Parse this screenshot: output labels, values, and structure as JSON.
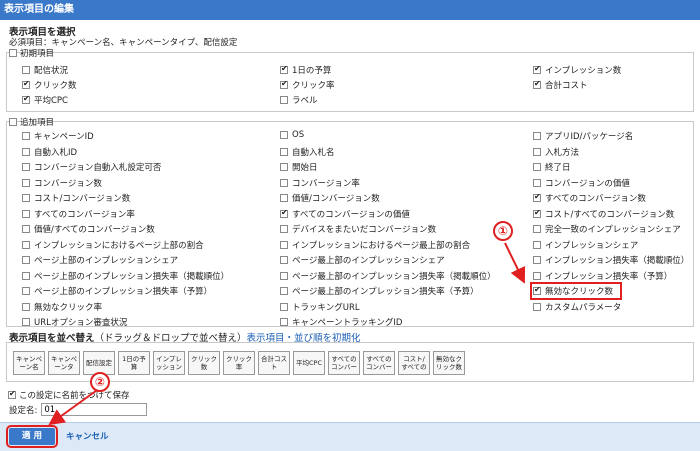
{
  "window": {
    "title": "表示項目の編集"
  },
  "select_section": {
    "heading": "表示項目を選択",
    "required_note": "必須項目：キャンペーン名、キャンペーンタイプ、配信設定"
  },
  "initial_group": {
    "label": "初期項目",
    "checked": false,
    "items": [
      {
        "label": "配信状況",
        "checked": false
      },
      {
        "label": "1日の予算",
        "checked": true
      },
      {
        "label": "インプレッション数",
        "checked": true
      },
      {
        "label": "クリック数",
        "checked": true
      },
      {
        "label": "クリック率",
        "checked": true
      },
      {
        "label": "合計コスト",
        "checked": true
      },
      {
        "label": "平均CPC",
        "checked": true
      },
      {
        "label": "ラベル",
        "checked": false
      }
    ]
  },
  "additional_group": {
    "label": "追加項目",
    "checked": false,
    "items": [
      {
        "label": "キャンペーンID",
        "checked": false
      },
      {
        "label": "OS",
        "checked": false
      },
      {
        "label": "アプリID/パッケージ名",
        "checked": false
      },
      {
        "label": "自動入札ID",
        "checked": false
      },
      {
        "label": "自動入札名",
        "checked": false
      },
      {
        "label": "入札方法",
        "checked": false
      },
      {
        "label": "コンバージョン自動入札設定可否",
        "checked": false
      },
      {
        "label": "開始日",
        "checked": false
      },
      {
        "label": "終了日",
        "checked": false
      },
      {
        "label": "コンバージョン数",
        "checked": false
      },
      {
        "label": "コンバージョン率",
        "checked": false
      },
      {
        "label": "コンバージョンの価値",
        "checked": false
      },
      {
        "label": "コスト/コンバージョン数",
        "checked": false
      },
      {
        "label": "価値/コンバージョン数",
        "checked": false
      },
      {
        "label": "すべてのコンバージョン数",
        "checked": true
      },
      {
        "label": "すべてのコンバージョン率",
        "checked": false
      },
      {
        "label": "すべてのコンバージョンの価値",
        "checked": true
      },
      {
        "label": "コスト/すべてのコンバージョン数",
        "checked": true
      },
      {
        "label": "価値/すべてのコンバージョン数",
        "checked": false
      },
      {
        "label": "デバイスをまたいだコンバージョン数",
        "checked": false
      },
      {
        "label": "完全一致のインプレッションシェア",
        "checked": false
      },
      {
        "label": "インプレッションにおけるページ上部の割合",
        "checked": false
      },
      {
        "label": "インプレッションにおけるページ最上部の割合",
        "checked": false
      },
      {
        "label": "インプレッションシェア",
        "checked": false
      },
      {
        "label": "ページ上部のインプレッションシェア",
        "checked": false
      },
      {
        "label": "ページ最上部のインプレッションシェア",
        "checked": false
      },
      {
        "label": "インプレッション損失率（掲載順位）",
        "checked": false
      },
      {
        "label": "ページ上部のインプレッション損失率（掲載順位）",
        "checked": false
      },
      {
        "label": "ページ最上部のインプレッション損失率（掲載順位）",
        "checked": false
      },
      {
        "label": "インプレッション損失率（予算）",
        "checked": false
      },
      {
        "label": "ページ上部のインプレッション損失率（予算）",
        "checked": false
      },
      {
        "label": "ページ最上部のインプレッション損失率（予算）",
        "checked": false
      },
      {
        "label": "無効なクリック数",
        "checked": true
      },
      {
        "label": "無効なクリック率",
        "checked": false
      },
      {
        "label": "トラッキングURL",
        "checked": false
      },
      {
        "label": "カスタムパラメータ",
        "checked": false
      },
      {
        "label": "URLオプション審査状況",
        "checked": false
      },
      {
        "label": "キャンペーントラッキングID",
        "checked": false
      }
    ]
  },
  "sort_section": {
    "heading": "表示項目を並べ替え",
    "hint": "（ドラッグ＆ドロップで並べ替え）",
    "reset_link": "表示項目・並び順を初期化"
  },
  "chips": [
    "キャンペ\nーン名",
    "キャンペ\nーンタ",
    "配信設定",
    "1日の予\n算",
    "インプレ\nッション",
    "クリック\n数",
    "クリック\n率",
    "合計コス\nト",
    "平均CPC",
    "すべての\nコンバー",
    "すべての\nコンバー",
    "コスト/\nすべての",
    "無効なク\nリック数"
  ],
  "save_setting": {
    "label": "この設定に名前をつけて保存",
    "checked": true
  },
  "setting_name": {
    "label": "設定名:",
    "value": "01"
  },
  "footer": {
    "apply_label": "適 用",
    "cancel_label": "キャンセル"
  },
  "annotations": {
    "marker_1": "①",
    "marker_2": "②",
    "color": "#e02020"
  }
}
